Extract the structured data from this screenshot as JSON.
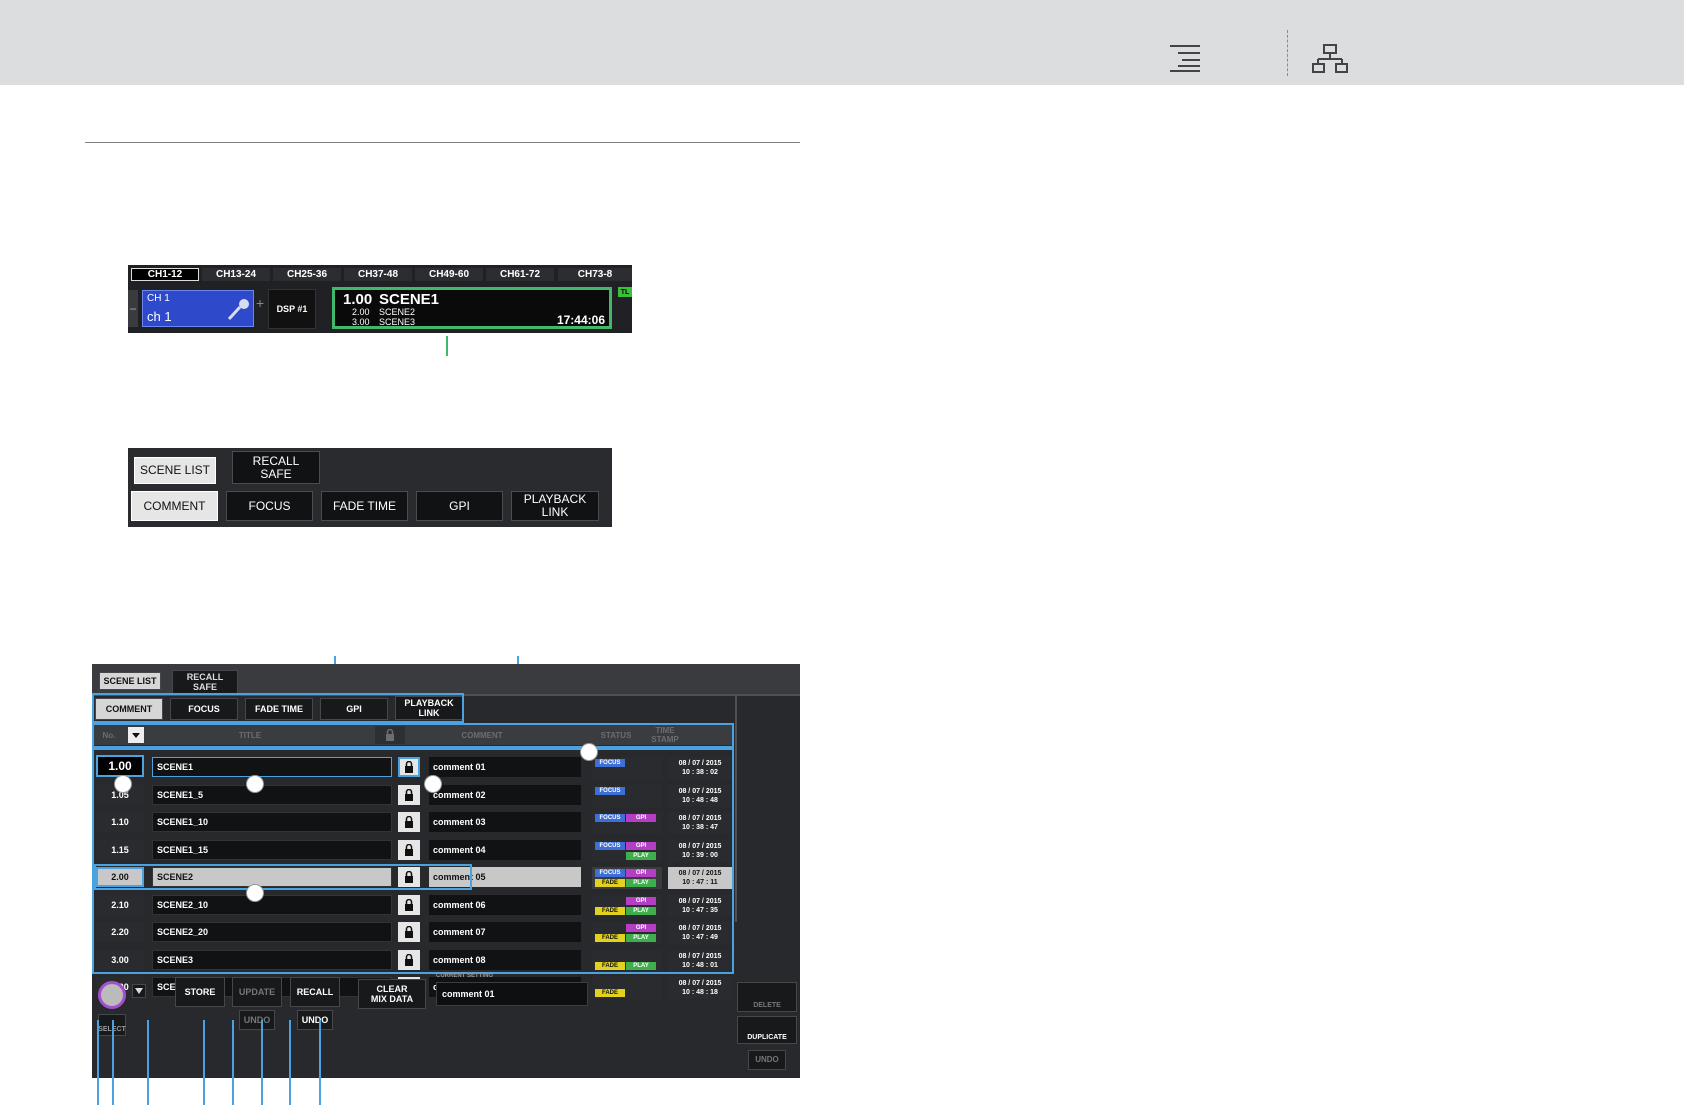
{
  "panel1": {
    "channel_tabs": [
      "CH1-12",
      "CH13-24",
      "CH25-36",
      "CH37-48",
      "CH49-60",
      "CH61-72",
      "CH73-8"
    ],
    "channel": {
      "id": "CH  1",
      "name": "ch 1"
    },
    "dsp": "DSP #1",
    "scene": {
      "current_number": "1.00",
      "current_title": "SCENE1",
      "next": [
        {
          "number": "2.00",
          "title": "SCENE2"
        },
        {
          "number": "3.00",
          "title": "SCENE3"
        }
      ],
      "time": "17:44:06"
    },
    "tl_badge": "TL"
  },
  "panel2": {
    "tabs": [
      "SCENE LIST",
      "RECALL\nSAFE"
    ],
    "views": [
      "COMMENT",
      "FOCUS",
      "FADE TIME",
      "GPI",
      "PLAYBACK\nLINK"
    ]
  },
  "panel3": {
    "tabs": [
      "SCENE LIST",
      "RECALL\nSAFE"
    ],
    "views": [
      "COMMENT",
      "FOCUS",
      "FADE TIME",
      "GPI",
      "PLAYBACK\nLINK"
    ],
    "columns": {
      "no": "No.",
      "title": "TITLE",
      "comment": "COMMENT",
      "status": "STATUS",
      "timestamp": "TIME\nSTAMP"
    },
    "rows": [
      {
        "no": "1.00",
        "title": "SCENE1",
        "comment": "comment 01",
        "tags": [
          "FOCUS"
        ],
        "date": "08 / 07 / 2015",
        "time": "10 : 38 : 02"
      },
      {
        "no": "1.05",
        "title": "SCENE1_5",
        "comment": "comment 02",
        "tags": [
          "FOCUS"
        ],
        "date": "08 / 07 / 2015",
        "time": "10 : 48 : 48"
      },
      {
        "no": "1.10",
        "title": "SCENE1_10",
        "comment": "comment 03",
        "tags": [
          "FOCUS",
          "GPI"
        ],
        "date": "08 / 07 / 2015",
        "time": "10 : 38 : 47"
      },
      {
        "no": "1.15",
        "title": "SCENE1_15",
        "comment": "comment 04",
        "tags": [
          "FOCUS",
          "GPI",
          "PLAY"
        ],
        "date": "08 / 07 / 2015",
        "time": "10 : 39 : 00"
      },
      {
        "no": "2.00",
        "title": "SCENE2",
        "comment": "comment 05",
        "tags": [
          "FOCUS",
          "GPI",
          "FADE",
          "PLAY"
        ],
        "date": "08 / 07 / 2015",
        "time": "10 : 47 : 11"
      },
      {
        "no": "2.10",
        "title": "SCENE2_10",
        "comment": "comment 06",
        "tags": [
          "GPI",
          "FADE",
          "PLAY"
        ],
        "date": "08 / 07 / 2015",
        "time": "10 : 47 : 35"
      },
      {
        "no": "2.20",
        "title": "SCENE2_20",
        "comment": "comment 07",
        "tags": [
          "GPI",
          "FADE",
          "PLAY"
        ],
        "date": "08 / 07 / 2015",
        "time": "10 : 47 : 49"
      },
      {
        "no": "3.00",
        "title": "SCENE3",
        "comment": "comment 08",
        "tags": [
          "FADE",
          "PLAY"
        ],
        "date": "08 / 07 / 2015",
        "time": "10 : 48 : 01"
      },
      {
        "no": "5.00",
        "title": "SCENE5",
        "comment": "comment 09",
        "tags": [
          "FADE"
        ],
        "date": "08 / 07 / 2015",
        "time": "10 : 48 : 18"
      }
    ],
    "buttons": {
      "select": "SELECT",
      "store": "STORE",
      "update": "UPDATE",
      "recall": "RECALL",
      "undo_update": "UNDO",
      "undo_recall": "UNDO",
      "clear_mix": "CLEAR\nMIX DATA",
      "delete": "DELETE",
      "duplicate": "DUPLICATE",
      "undo_side": "UNDO"
    },
    "current_setting": {
      "label": "CURRENT SETTING",
      "value": "comment 01"
    }
  },
  "colors": {
    "highlight_green": "#44b86a",
    "callout_blue": "#4aa3e0",
    "focus": "#3d6fd6",
    "gpi": "#b43fc4",
    "fade": "#e2d21f",
    "play": "#3fae4c"
  }
}
